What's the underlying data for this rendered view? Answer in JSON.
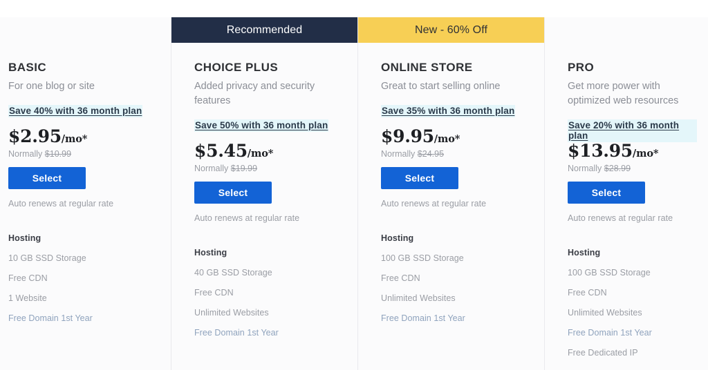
{
  "page": {
    "background": "#ffffff",
    "card_background": "#fbfbfc",
    "divider_color": "#e9e9ed",
    "accent_button_color": "#1363d6",
    "banner_recommended_color": "#222e47",
    "banner_promo_color": "#f7cf55",
    "save_highlight_color": "#e4f6fa"
  },
  "plans": [
    {
      "banner": "",
      "banner_type": "none",
      "name": "BASIC",
      "tagline": "For one blog or site",
      "save_link": "Save 40% with 36 month plan",
      "price": "$2.95",
      "price_suffix": "/mo*",
      "normally_label": "Normally",
      "normally_price": "$10.99",
      "select_label": "Select",
      "auto_renews": "Auto renews at regular rate",
      "features_heading": "Hosting",
      "features": [
        {
          "label": "10 GB SSD Storage",
          "accent": false
        },
        {
          "label": "Free CDN",
          "accent": false
        },
        {
          "label": "1 Website",
          "accent": false
        },
        {
          "label": "Free Domain 1st Year",
          "accent": true
        }
      ]
    },
    {
      "banner": "Recommended",
      "banner_type": "recommended",
      "name": "CHOICE PLUS",
      "tagline": "Added privacy and security features",
      "save_link": "Save 50% with 36 month plan",
      "price": "$5.45",
      "price_suffix": "/mo*",
      "normally_label": "Normally",
      "normally_price": "$19.99",
      "select_label": "Select",
      "auto_renews": "Auto renews at regular rate",
      "features_heading": "Hosting",
      "features": [
        {
          "label": "40 GB SSD Storage",
          "accent": false
        },
        {
          "label": "Free CDN",
          "accent": false
        },
        {
          "label": "Unlimited Websites",
          "accent": false
        },
        {
          "label": "Free Domain 1st Year",
          "accent": true
        }
      ]
    },
    {
      "banner": "New - 60% Off",
      "banner_type": "promo",
      "name": "ONLINE STORE",
      "tagline": "Great to start selling online",
      "save_link": "Save 35% with 36 month plan",
      "price": "$9.95",
      "price_suffix": "/mo*",
      "normally_label": "Normally",
      "normally_price": "$24.95",
      "select_label": "Select",
      "auto_renews": "Auto renews at regular rate",
      "features_heading": "Hosting",
      "features": [
        {
          "label": "100 GB SSD Storage",
          "accent": false
        },
        {
          "label": "Free CDN",
          "accent": false
        },
        {
          "label": "Unlimited Websites",
          "accent": false
        },
        {
          "label": "Free Domain 1st Year",
          "accent": true
        }
      ]
    },
    {
      "banner": "",
      "banner_type": "none",
      "name": "PRO",
      "tagline": "Get more power with optimized web resources",
      "save_link": "Save 20% with 36 month plan",
      "price": "$13.95",
      "price_suffix": "/mo*",
      "normally_label": "Normally",
      "normally_price": "$28.99",
      "select_label": "Select",
      "auto_renews": "Auto renews at regular rate",
      "features_heading": "Hosting",
      "features": [
        {
          "label": "100 GB SSD Storage",
          "accent": false
        },
        {
          "label": "Free CDN",
          "accent": false
        },
        {
          "label": "Unlimited Websites",
          "accent": false
        },
        {
          "label": "Free Domain 1st Year",
          "accent": true
        },
        {
          "label": "Free Dedicated IP",
          "accent": false
        }
      ]
    }
  ]
}
